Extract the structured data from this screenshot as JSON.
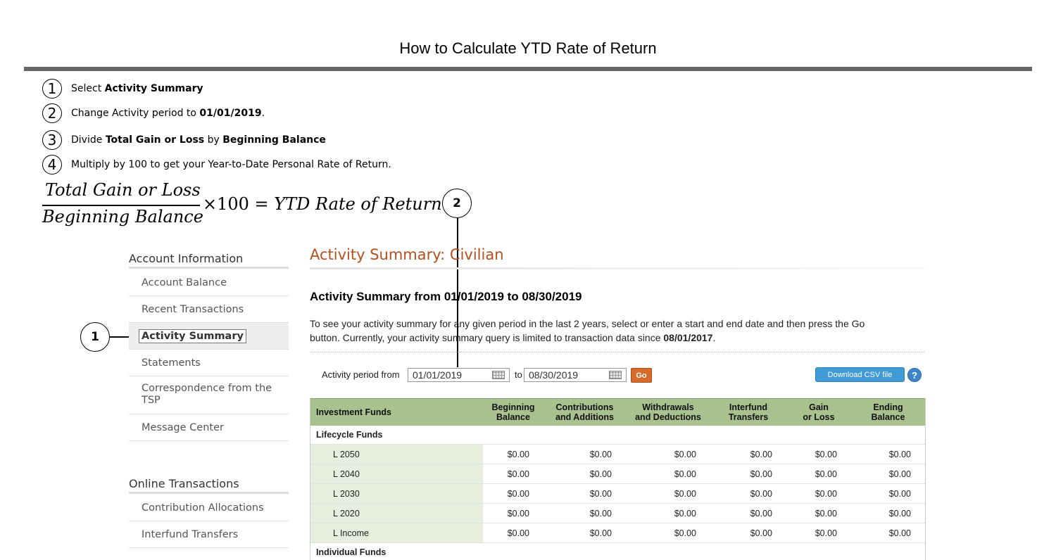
{
  "doc": {
    "title": "How to Calculate YTD Rate of Return",
    "steps": [
      {
        "num": "1",
        "pre": "Select ",
        "bold1": "Activity Summary",
        "mid": "",
        "bold2": "",
        "post": ""
      },
      {
        "num": "2",
        "pre": "Change Activity period to ",
        "bold1": "01/01/2019",
        "mid": "",
        "bold2": "",
        "post": "."
      },
      {
        "num": "3",
        "pre": "Divide ",
        "bold1": "Total Gain or Loss",
        "mid": " by ",
        "bold2": "Beginning Balance",
        "post": ""
      },
      {
        "num": "4",
        "pre": "Multiply by 100 to get your Year-to-Date Personal Rate of Return.",
        "bold1": "",
        "mid": "",
        "bold2": "",
        "post": ""
      }
    ],
    "formula": {
      "numerator": "Total Gain or Loss",
      "denominator": "Beginning Balance",
      "operator": "×100 = ",
      "result": "YTD Rate of Return"
    },
    "callouts": {
      "one": "1",
      "two": "2"
    }
  },
  "sidebar": {
    "account_heading": "Account Information",
    "account_items": [
      {
        "label": "Account Balance"
      },
      {
        "label": "Recent Transactions"
      },
      {
        "label": "Activity Summary",
        "active": true
      },
      {
        "label": "Statements"
      },
      {
        "label": "Correspondence from the TSP"
      },
      {
        "label": "Message Center"
      }
    ],
    "transactions_heading": "Online Transactions",
    "transaction_items": [
      {
        "label": "Contribution Allocations"
      },
      {
        "label": "Interfund Transfers"
      }
    ]
  },
  "main": {
    "title": "Activity Summary: Civilian",
    "subtitle": "Activity Summary from 01/01/2019 to 08/30/2019",
    "intro_line1": "To see your activity summary for any given period in the last 2 years, select or enter a start and end date and then press the Go",
    "intro_line2_pre": "button. Currently, your activity summary query is limited to transaction data since ",
    "intro_line2_bold": "08/01/2017",
    "intro_line2_post": ".",
    "period_label": "Activity period from",
    "from_date": "01/01/2019",
    "to_label": "to",
    "to_date": "08/30/2019",
    "go_label": "Go",
    "csv_label": "Download CSV file",
    "help_label": "?"
  },
  "table": {
    "headers": [
      {
        "l1": "Investment Funds",
        "l2": ""
      },
      {
        "l1": "Beginning",
        "l2": "Balance"
      },
      {
        "l1": "Contributions",
        "l2": "and Additions"
      },
      {
        "l1": "Withdrawals",
        "l2": "and Deductions"
      },
      {
        "l1": "Interfund",
        "l2": "Transfers"
      },
      {
        "l1": "Gain",
        "l2": "or Loss"
      },
      {
        "l1": "Ending",
        "l2": "Balance"
      }
    ],
    "group_lifecycle": "Lifecycle Funds",
    "rows": [
      {
        "fund": "L 2050",
        "values": [
          "$0.00",
          "$0.00",
          "$0.00",
          "$0.00",
          "$0.00",
          "$0.00"
        ]
      },
      {
        "fund": "L 2040",
        "values": [
          "$0.00",
          "$0.00",
          "$0.00",
          "$0.00",
          "$0.00",
          "$0.00"
        ]
      },
      {
        "fund": "L 2030",
        "values": [
          "$0.00",
          "$0.00",
          "$0.00",
          "$0.00",
          "$0.00",
          "$0.00"
        ]
      },
      {
        "fund": "L 2020",
        "values": [
          "$0.00",
          "$0.00",
          "$0.00",
          "$0.00",
          "$0.00",
          "$0.00"
        ]
      },
      {
        "fund": "L Income",
        "values": [
          "$0.00",
          "$0.00",
          "$0.00",
          "$0.00",
          "$0.00",
          "$0.00"
        ]
      }
    ],
    "group_individual": "Individual Funds"
  },
  "colors": {
    "accent": "#b3501d",
    "table_header": "#a9c18e",
    "go_button": "#d56a2a",
    "csv_button": "#3f9ad6"
  }
}
